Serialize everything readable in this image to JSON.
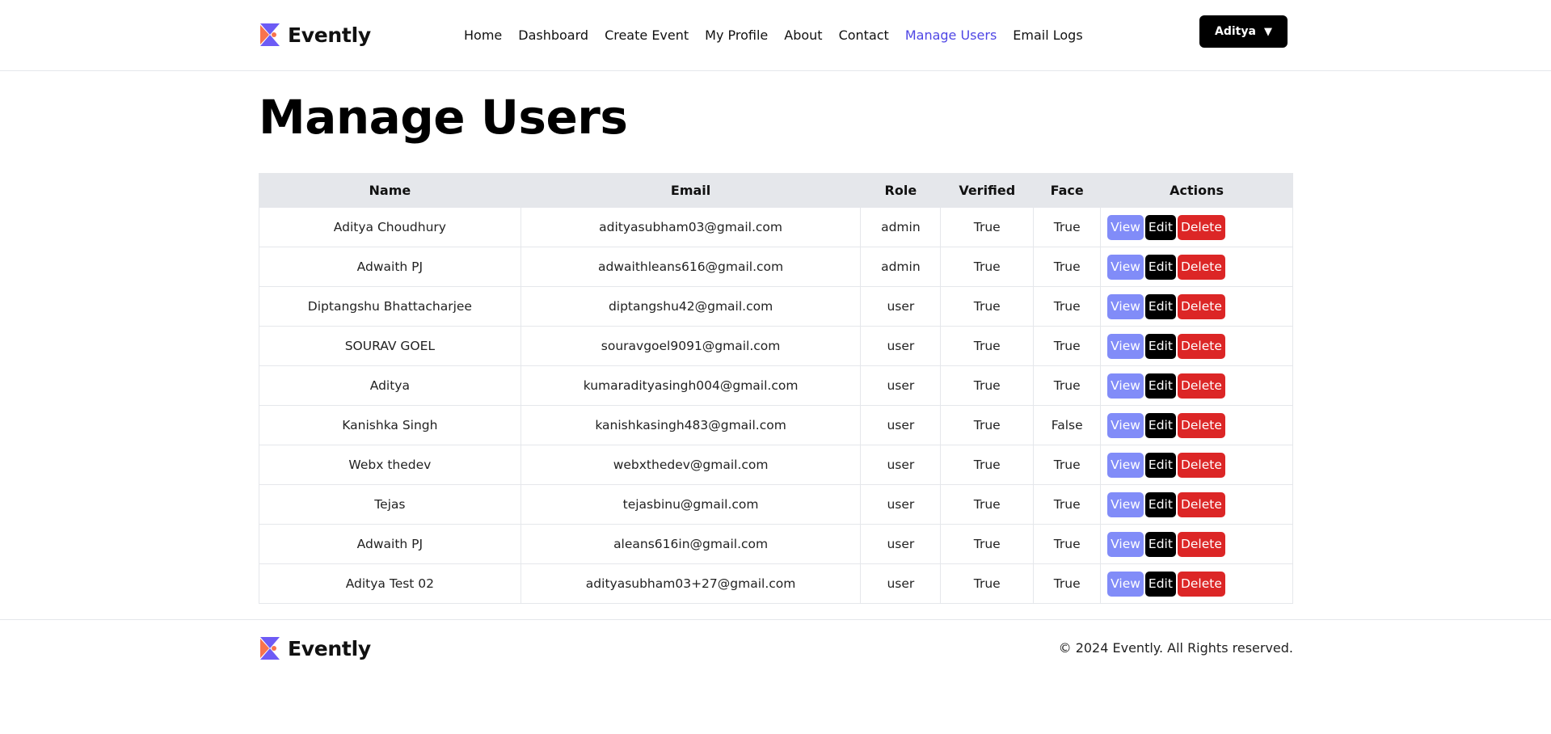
{
  "brand": {
    "name": "Evently",
    "logo_icon": "evently-logo-icon"
  },
  "nav": [
    {
      "label": "Home",
      "active": false
    },
    {
      "label": "Dashboard",
      "active": false
    },
    {
      "label": "Create Event",
      "active": false
    },
    {
      "label": "My Profile",
      "active": false
    },
    {
      "label": "About",
      "active": false
    },
    {
      "label": "Contact",
      "active": false
    },
    {
      "label": "Manage Users",
      "active": true
    },
    {
      "label": "Email Logs",
      "active": false
    }
  ],
  "user_menu": {
    "label": "Aditya",
    "caret": "▼"
  },
  "page": {
    "title": "Manage Users"
  },
  "table": {
    "columns": [
      "Name",
      "Email",
      "Role",
      "Verified",
      "Face",
      "Actions"
    ],
    "action_labels": {
      "view": "View",
      "edit": "Edit",
      "delete": "Delete"
    },
    "rows": [
      {
        "name": "Aditya Choudhury",
        "email": "adityasubham03@gmail.com",
        "role": "admin",
        "verified": "True",
        "face": "True"
      },
      {
        "name": "Adwaith PJ",
        "email": "adwaithleans616@gmail.com",
        "role": "admin",
        "verified": "True",
        "face": "True"
      },
      {
        "name": "Diptangshu Bhattacharjee",
        "email": "diptangshu42@gmail.com",
        "role": "user",
        "verified": "True",
        "face": "True"
      },
      {
        "name": "SOURAV GOEL",
        "email": "souravgoel9091@gmail.com",
        "role": "user",
        "verified": "True",
        "face": "True"
      },
      {
        "name": "Aditya",
        "email": "kumaradityasingh004@gmail.com",
        "role": "user",
        "verified": "True",
        "face": "True"
      },
      {
        "name": "Kanishka Singh",
        "email": "kanishkasingh483@gmail.com",
        "role": "user",
        "verified": "True",
        "face": "False"
      },
      {
        "name": "Webx thedev",
        "email": "webxthedev@gmail.com",
        "role": "user",
        "verified": "True",
        "face": "True"
      },
      {
        "name": "Tejas",
        "email": "tejasbinu@gmail.com",
        "role": "user",
        "verified": "True",
        "face": "True"
      },
      {
        "name": "Adwaith PJ",
        "email": "aleans616in@gmail.com",
        "role": "user",
        "verified": "True",
        "face": "True"
      },
      {
        "name": "Aditya Test 02",
        "email": "adityasubham03+27@gmail.com",
        "role": "user",
        "verified": "True",
        "face": "True"
      }
    ]
  },
  "footer": {
    "copyright": "© 2024 Evently. All Rights reserved."
  },
  "colors": {
    "accent": "#4f46e5",
    "view": "#818cf8",
    "edit": "#000000",
    "delete": "#dc2626",
    "header_bg": "#e5e7eb"
  }
}
